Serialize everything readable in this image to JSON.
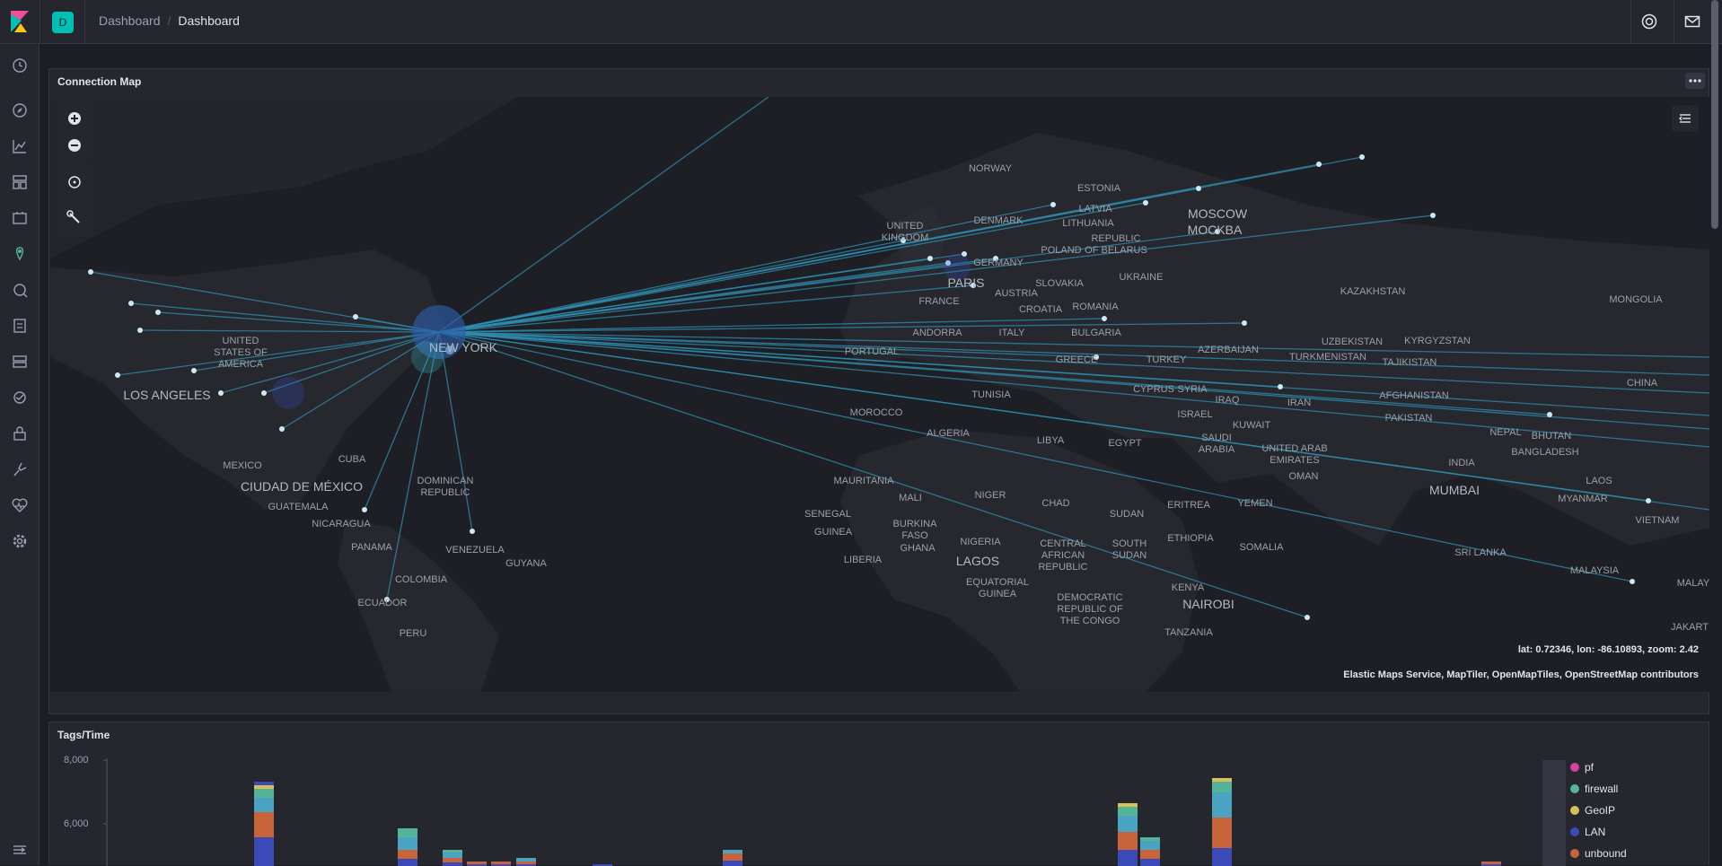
{
  "app": {
    "logo": "kibana-logo",
    "space_initial": "D",
    "breadcrumbs": [
      "Dashboard",
      "Dashboard"
    ]
  },
  "top_icons": [
    "help-icon",
    "newsfeed-icon"
  ],
  "sidenav": {
    "items": [
      "recent-icon",
      "discover-icon",
      "visualize-icon",
      "dashboard-icon",
      "canvas-icon",
      "maps-icon",
      "ml-icon",
      "logs-icon",
      "infrastructure-icon",
      "apm-icon",
      "siem-icon",
      "dev-tools-icon",
      "monitoring-icon",
      "management-icon"
    ],
    "collapse_icon": "dock-icon"
  },
  "map_panel": {
    "title": "Connection Map",
    "coordinates": "lat: 0.72346, lon: -86.10893, zoom: 2.42",
    "attribution": "Elastic Maps Service, MapTiler, OpenMapTiles, OpenStreetMap contributors",
    "labels": {
      "norway": "NORWAY",
      "estonia": "ESTONIA",
      "latvia": "LATVIA",
      "lithuania": "LITHUANIA",
      "moscow": "MOSCOW",
      "mockba": "MOCKBA",
      "republic_of_belarus": "REPUBLIC OF BELARUS",
      "united_kingdom": "UNITED KINGDOM",
      "denmark": "DENMARK",
      "poland": "POLAND",
      "germany": "GERMANY",
      "ukraine": "UKRAINE",
      "paris": "PARIS",
      "slovakia": "SLOVAKIA",
      "kazakhstan": "KAZAKHSTAN",
      "mongolia": "MONGOLIA",
      "france": "FRANCE",
      "austria": "AUSTRIA",
      "croatia": "CROATIA",
      "romania": "ROMANIA",
      "andorra": "ANDORRA",
      "italy": "ITALY",
      "bulgaria": "BULGARIA",
      "uzbekistan": "UZBEKISTAN",
      "kyrgyzstan": "KYRGYZSTAN",
      "azerbaijan": "AZERBAIJAN",
      "turkmenistan": "TURKMENISTAN",
      "tajikistan": "TAJIKISTAN",
      "portugal": "PORTUGAL",
      "greece": "GREECE",
      "turkey": "TURKEY",
      "new_york": "NEW YORK",
      "united_states": "UNITED STATES OF AMERICA",
      "los_angeles": "LOS ANGELES",
      "cyprus": "CYPRUS",
      "syria": "SYRIA",
      "iraq": "IRAQ",
      "iran": "IRAN",
      "afghanistan": "AFGHANISTAN",
      "china": "CHINA",
      "tunisia": "TUNISIA",
      "morocco": "MOROCCO",
      "israel": "ISRAEL",
      "kuwait": "KUWAIT",
      "pakistan": "PAKISTAN",
      "nepal": "NEPAL",
      "bhutan": "BHUTAN",
      "algeria": "ALGERIA",
      "libya": "LIBYA",
      "egypt": "EGYPT",
      "saudi_arabia": "SAUDI ARABIA",
      "united_arab_emirates": "UNITED ARAB EMIRATES",
      "bangladesh": "BANGLADESH",
      "mexico": "MEXICO",
      "cuba": "CUBA",
      "india": "INDIA",
      "oman": "OMAN",
      "ciudad_de_mexico": "CIUDAD DE MÉXICO",
      "dominican_republic": "DOMINICAN REPUBLIC",
      "mauritania": "MAURITANIA",
      "niger": "NIGER",
      "mumbai": "MUMBAI",
      "laos": "LAOS",
      "guatemala": "GUATEMALA",
      "mali": "MALI",
      "chad": "CHAD",
      "sudan": "SUDAN",
      "eritrea": "ERITREA",
      "yemen": "YEMEN",
      "myanmar": "MYANMAR",
      "senegal": "SENEGAL",
      "nicaragua": "NICARAGUA",
      "vietnam": "VIETNAM",
      "burkina_faso": "BURKINA FASO",
      "guinea": "GUINEA",
      "ethiopia": "ETHIOPIA",
      "panama": "PANAMA",
      "venezuela": "VENEZUELA",
      "nigeria": "NIGERIA",
      "somalia": "SOMALIA",
      "central_african_republic": "CENTRAL AFRICAN REPUBLIC",
      "south_sudan": "SOUTH SUDAN",
      "ghana": "GHANA",
      "liberia": "LIBERIA",
      "lagos": "LAGOS",
      "sri_lanka": "SRI LANKA",
      "guyana": "GUYANA",
      "malaysia": "MALAYSIA",
      "colombia": "COLOMBIA",
      "equatorial_guinea": "EQUATORIAL GUINEA",
      "kenya": "KENYA",
      "malay": "MALAY",
      "ecuador": "ECUADOR",
      "democratic_republic_congo": "DEMOCRATIC REPUBLIC OF THE CONGO",
      "nairobi": "NAIROBI",
      "jakart": "JAKART",
      "peru": "PERU",
      "tanzania": "TANZANIA"
    }
  },
  "chart_panel": {
    "title": "Tags/Time",
    "chart_data": {
      "type": "bar",
      "stacked": true,
      "y_ticks": [
        "8,000",
        "6,000"
      ],
      "legend_position": "right",
      "series": [
        {
          "name": "pf",
          "color": "#d6409f"
        },
        {
          "name": "firewall",
          "color": "#54b399"
        },
        {
          "name": "GeoIP",
          "color": "#d6bf57"
        },
        {
          "name": "LAN",
          "color": "#6092c0"
        },
        {
          "name": "unbound",
          "color": "#ca8eae"
        }
      ]
    }
  }
}
